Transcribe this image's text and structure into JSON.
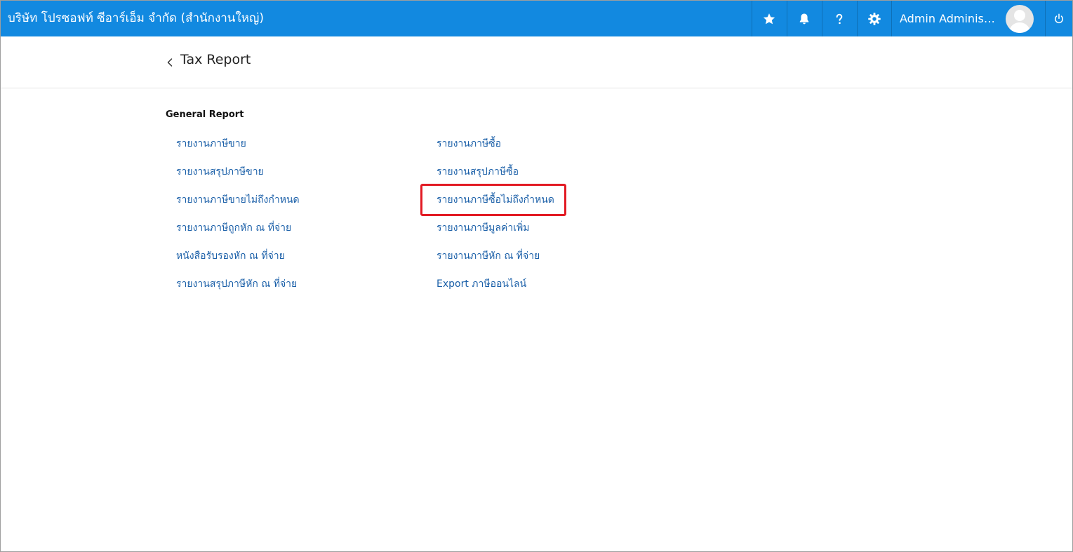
{
  "header": {
    "company": "บริษัท โปรซอฟท์ ซีอาร์เอ็ม จำกัด (สำนักงานใหญ่)",
    "user_name": "Admin Administr...",
    "icons": [
      "star-icon",
      "bell-icon",
      "help-icon",
      "gear-icon",
      "avatar",
      "power-icon"
    ],
    "accent_color": "#1289e0"
  },
  "page": {
    "title": "Tax Report"
  },
  "section": {
    "title": "General Report"
  },
  "reports": {
    "left": [
      "รายงานภาษีขาย",
      "รายงานสรุปภาษีขาย",
      "รายงานภาษีขายไม่ถึงกำหนด",
      "รายงานภาษีถูกหัก ณ ที่จ่าย",
      "หนังสือรับรองหัก ณ ที่จ่าย",
      "รายงานสรุปภาษีหัก ณ ที่จ่าย"
    ],
    "right": [
      "รายงานภาษีซื้อ",
      "รายงานสรุปภาษีซื้อ",
      "รายงานภาษีซื้อไม่ถึงกำหนด",
      "รายงานภาษีมูลค่าเพิ่ม",
      "รายงานภาษีหัก ณ ที่จ่าย",
      "Export ภาษีออนไลน์"
    ],
    "highlighted": "รายงานภาษีซื้อไม่ถึงกำหนด",
    "link_color": "#1a5fa8",
    "highlight_color": "#e21b24"
  }
}
